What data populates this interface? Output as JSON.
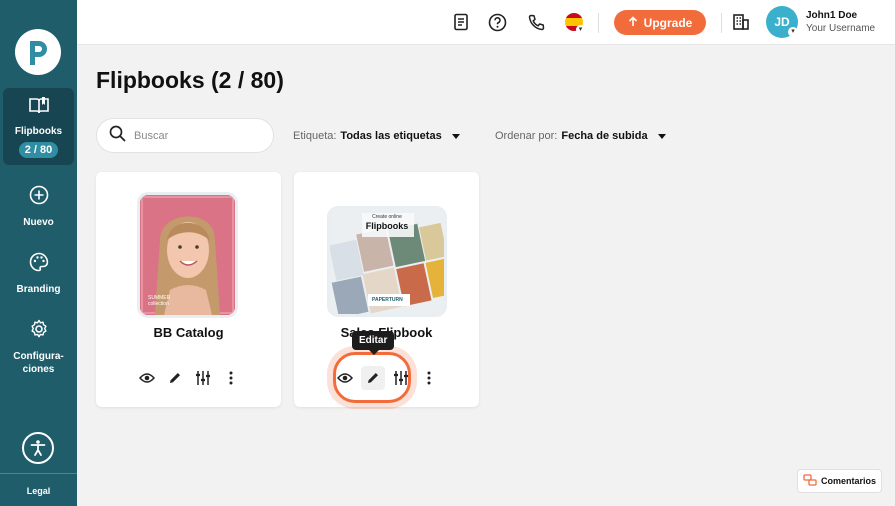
{
  "sidebar": {
    "items": [
      {
        "label": "Flipbooks",
        "count": "2 / 80",
        "icon": "book-icon"
      },
      {
        "label": "Nuevo",
        "icon": "plus-circle-icon"
      },
      {
        "label": "Branding",
        "icon": "palette-icon"
      },
      {
        "label": "Configura-ciones",
        "icon": "gear-icon"
      }
    ],
    "legal": "Legal"
  },
  "topbar": {
    "upgrade_label": "Upgrade",
    "avatar_initials": "JD",
    "user_name": "John1 Doe",
    "user_sub": "Your Username",
    "language": "es"
  },
  "main": {
    "title": "Flipbooks (2 / 80)",
    "search_placeholder": "Buscar",
    "tag_filter_label": "Etiqueta:",
    "tag_filter_value": "Todas las etiquetas",
    "sort_label": "Ordenar por:",
    "sort_value": "Fecha de subida"
  },
  "cards": [
    {
      "title": "BB Catalog",
      "thumb_text": "SUMMER collection"
    },
    {
      "title": "Sales Flipbook",
      "thumb_title": "Create online",
      "thumb_subtitle": "Flipbooks",
      "thumb_brand": "PAPERTURN"
    }
  ],
  "tooltip": "Editar",
  "feedback_label": "Comentarios",
  "colors": {
    "sidebar": "#1f5d6b",
    "accent": "#f26b3a",
    "avatar": "#3ab0cc"
  }
}
